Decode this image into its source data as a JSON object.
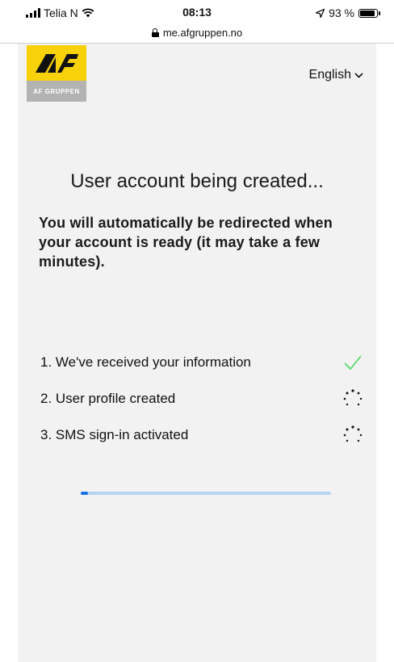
{
  "status_bar": {
    "carrier": "Telia N",
    "time": "08:13",
    "battery_text": "93 %",
    "battery_level": 0.93
  },
  "url_bar": {
    "domain": "me.afgruppen.no"
  },
  "header": {
    "logo_text": "AF GRUPPEN",
    "language": "English"
  },
  "main": {
    "title": "User account being created...",
    "subtitle": "You will automatically be redirected when your account is ready (it may take a few minutes).",
    "steps": [
      {
        "label": "1. We've received your information",
        "state": "done",
        "icon": "check-icon"
      },
      {
        "label": "2. User profile created",
        "state": "pending",
        "icon": "loading-spinner-icon"
      },
      {
        "label": "3. SMS sign-in activated",
        "state": "pending",
        "icon": "loading-spinner-icon"
      }
    ],
    "progress": 0.03
  },
  "colors": {
    "logo_yellow": "#f7d10a",
    "check_green": "#4cd964",
    "progress_fill": "#1a73e8",
    "progress_track": "#b7d4f3"
  }
}
